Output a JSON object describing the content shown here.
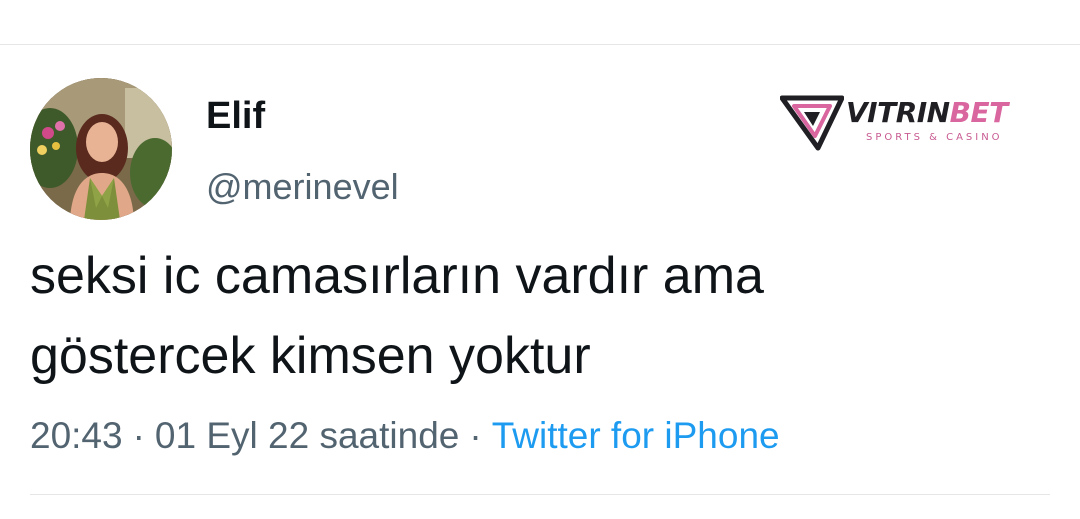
{
  "tweet": {
    "display_name": "Elif",
    "handle": "@merinevel",
    "text_lines": [
      "seksi ic camasırların vardır ama",
      "göstercek kimsen yoktur"
    ],
    "time": "20:43",
    "date": "01 Eyl 22 saatinde",
    "separator": "·",
    "source": "Twitter for iPhone"
  },
  "watermark": {
    "brand_main": "VITRIN",
    "brand_accent": "BET",
    "tagline": "SPORTS & CASINO"
  },
  "colors": {
    "text_primary": "#0f1419",
    "text_secondary": "#536471",
    "link": "#1d9bf0",
    "watermark_pink": "#d9669e",
    "divider": "#e6e6e6"
  }
}
